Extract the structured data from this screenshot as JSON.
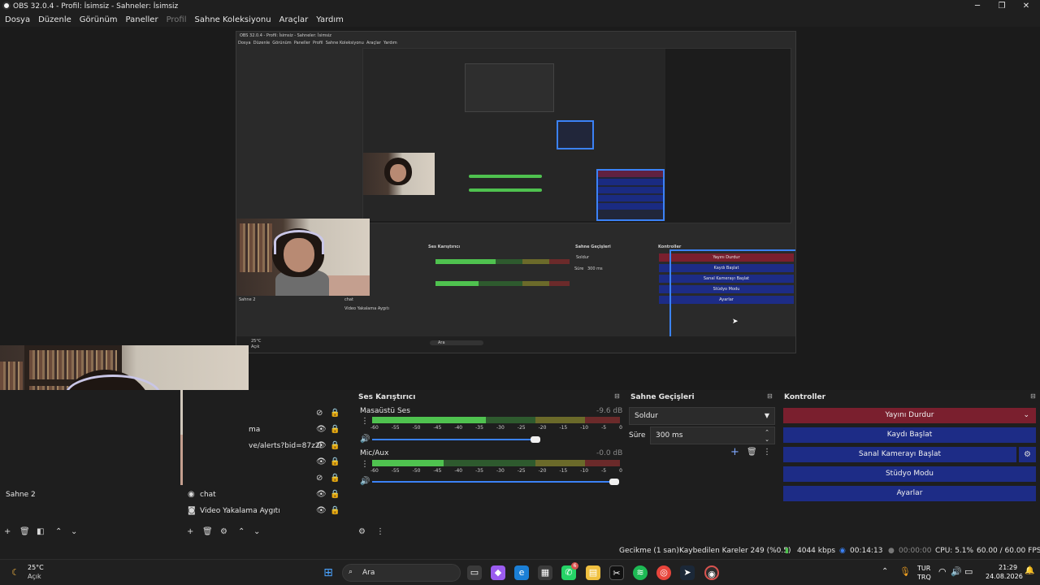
{
  "window": {
    "title": "OBS 32.0.4 - Profil: İsimsiz - Sahneler: İsimsiz",
    "controls": [
      "─",
      "❐",
      "✕"
    ]
  },
  "menu": [
    "Dosya",
    "Düzenle",
    "Görünüm",
    "Paneller",
    "Profil",
    "Sahne Koleksiyonu",
    "Araçlar",
    "Yardım"
  ],
  "scenes": {
    "items": [
      "Sahne 2"
    ]
  },
  "sources": {
    "items": [
      {
        "label": "ma"
      },
      {
        "label": "ve/alerts?bid=87z2l"
      },
      {
        "label": ""
      },
      {
        "label": ""
      },
      {
        "label": "chat"
      },
      {
        "label": "Video Yakalama Aygıtı"
      }
    ]
  },
  "audio_mixer": {
    "title": "Ses Karıştırıcı",
    "channels": [
      {
        "name": "Masaüstü Ses",
        "db": "-9.6 dB",
        "level": 0.46,
        "volume": 0.68
      },
      {
        "name": "Mic/Aux",
        "db": "-0.0 dB",
        "level": 0.29,
        "volume": 1.0
      }
    ],
    "ticks": [
      "-60",
      "-55",
      "-50",
      "-45",
      "-40",
      "-35",
      "-30",
      "-25",
      "-20",
      "-15",
      "-10",
      "-5",
      "0"
    ]
  },
  "transitions": {
    "title": "Sahne Geçişleri",
    "selected": "Soldur",
    "duration_label": "Süre",
    "duration_value": "300 ms"
  },
  "controls": {
    "title": "Kontroller",
    "buttons": [
      "Yayını Durdur",
      "Kaydı Başlat",
      "Sanal Kamerayı Başlat",
      "Stüdyo Modu",
      "Ayarlar"
    ]
  },
  "status": {
    "delay": "Gecikme (1 san)",
    "dropped": "Kaybedilen Kareler 249 (%0.5)",
    "bitrate": "4044 kbps",
    "stream_time": "00:14:13",
    "record_time": "00:00:00",
    "cpu": "CPU: 5.1%",
    "fps": "60.00 / 60.00 FPS"
  },
  "taskbar": {
    "weather_temp": "25°C",
    "weather_text": "Açık",
    "search_placeholder": "Ara",
    "lang_1": "TUR",
    "lang_2": "TRQ",
    "time": "21:29",
    "date": "24.08.2026",
    "badge": "6"
  },
  "nested_preview": {
    "menu": [
      "Dosya",
      "Düzenle",
      "Görünüm",
      "Paneller",
      "Profil",
      "Sahne Koleksiyonu",
      "Araçlar",
      "Yardım"
    ],
    "controls": [
      "Yayını Durdur",
      "Kaydı Başlat",
      "Sanal Kamerayı Başlat",
      "Stüdyo Modu",
      "Ayarlar"
    ],
    "scene": "Sahne 2",
    "sources": [
      "chat",
      "Video Yakalama Aygıtı"
    ],
    "mixer_title": "Ses Karıştırıcı",
    "transitions_title": "Sahne Geçişleri",
    "controls_title": "Kontroller",
    "transition": "Soldur",
    "duration_label": "Süre",
    "duration": "300 ms",
    "weather_temp": "25°C",
    "weather_text": "Açık",
    "search": "Ara"
  },
  "colors": {
    "accent_blue": "#1d2c86",
    "stop_red": "#7a1f2e",
    "selection": "#3b82f6",
    "meter_green": "#4fc24f"
  }
}
